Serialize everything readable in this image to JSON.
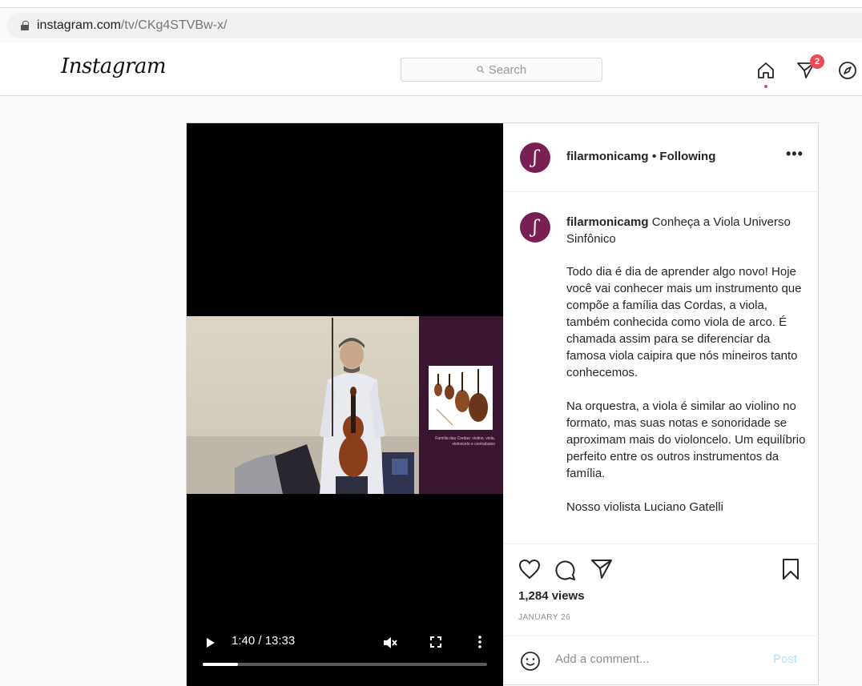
{
  "browser": {
    "url_host": "instagram.com",
    "url_path": "/tv/CKg4STVBw-x/"
  },
  "header": {
    "logo": "Instagram",
    "search_placeholder": "Search",
    "direct_badge_count": "2"
  },
  "post": {
    "username": "filarmonicamg",
    "follow_status": "• Following",
    "more_label": "•••",
    "caption_title": "Conheça a Viola Universo Sinfônico",
    "caption_paragraphs": [
      "Todo dia é dia de aprender algo novo! Hoje você vai conhecer mais um instrumento que compõe a família das Cordas, a viola, também conhecida como viola de arco. É chamada assim para se diferenciar da famosa viola caipira que nós mineiros tanto conhecemos.",
      "Na orquestra, a viola é similar ao violino no formato, mas suas notas e sonoridade se aproximam mais do violoncelo. Um equilíbrio perfeito entre os outros instrumentos da família.",
      "Nosso violista Luciano Gatelli"
    ],
    "video_panel_text": "Família das Cordas: violino, viola, violoncelo e contrabaixo",
    "video_time": "1:40 / 13:33",
    "video_progress": 0.125,
    "views": "1,284 views",
    "date": "JANUARY 26",
    "comment_placeholder": "Add a comment...",
    "post_button": "Post"
  },
  "colors": {
    "accent_red": "#ed4956",
    "avatar": "#7a1f52",
    "post_disabled": "#b2dffc"
  }
}
